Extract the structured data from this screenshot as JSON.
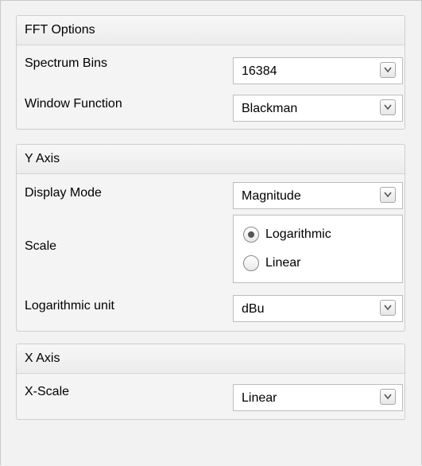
{
  "fft_options": {
    "title": "FFT Options",
    "spectrum_bins": {
      "label": "Spectrum Bins",
      "value": "16384"
    },
    "window_function": {
      "label": "Window Function",
      "value": "Blackman"
    }
  },
  "y_axis": {
    "title": "Y Axis",
    "display_mode": {
      "label": "Display Mode",
      "value": "Magnitude"
    },
    "scale": {
      "label": "Scale",
      "options": [
        {
          "label": "Logarithmic",
          "selected": true
        },
        {
          "label": "Linear",
          "selected": false
        }
      ]
    },
    "log_unit": {
      "label": "Logarithmic unit",
      "value": "dBu"
    }
  },
  "x_axis": {
    "title": "X Axis",
    "x_scale": {
      "label": "X-Scale",
      "value": "Linear"
    }
  },
  "icons": {
    "dropdown": "chevron-down-icon",
    "radio": "radio-icon"
  }
}
